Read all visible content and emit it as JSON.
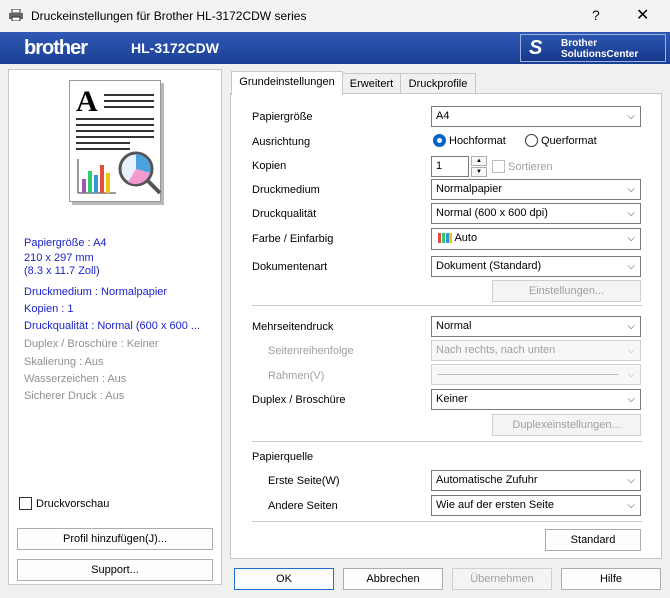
{
  "window": {
    "title": "Druckeinstellungen für Brother HL-3172CDW series",
    "help": "?",
    "close": "✕"
  },
  "brand": {
    "logo": "brother",
    "model": "HL-3172CDW",
    "solutions_line1": "Brother",
    "solutions_line2": "SolutionsCenter"
  },
  "summary": {
    "paper": "Papiergröße : A4",
    "dims1": "210 x 297 mm",
    "dims2": "(8.3 x 11.7 Zoll)",
    "media": "Druckmedium : Normalpapier",
    "copies": "Kopien : 1",
    "quality": "Druckqualität : Normal (600 x 600 ...",
    "duplex": "Duplex / Broschüre : Keiner",
    "scaling": "Skalierung : Aus",
    "watermark": "Wasserzeichen : Aus",
    "secure": "Sicherer Druck : Aus"
  },
  "left": {
    "preview_label": "Druckvorschau",
    "add_profile": "Profil hinzufügen(J)...",
    "support": "Support..."
  },
  "tabs": [
    "Grundeinstellungen",
    "Erweitert",
    "Druckprofile"
  ],
  "form": {
    "paper_label": "Papiergröße",
    "paper_value": "A4",
    "orientation_label": "Ausrichtung",
    "portrait": "Hochformat",
    "landscape": "Querformat",
    "copies_label": "Kopien",
    "copies_value": "1",
    "collate": "Sortieren",
    "media_label": "Druckmedium",
    "media_value": "Normalpapier",
    "quality_label": "Druckqualität",
    "quality_value": "Normal (600 x 600 dpi)",
    "color_label": "Farbe / Einfarbig",
    "color_value": "Auto",
    "doctype_label": "Dokumentenart",
    "doctype_value": "Dokument (Standard)",
    "settings_btn": "Einstellungen...",
    "multipage_label": "Mehrseitendruck",
    "multipage_value": "Normal",
    "order_label": "Seitenreihenfolge",
    "order_value": "Nach rechts, nach unten",
    "border_label": "Rahmen(V)",
    "duplex_label": "Duplex / Broschüre",
    "duplex_value": "Keiner",
    "duplex_btn": "Duplexeinstellungen...",
    "source_label": "Papierquelle",
    "first_label": "Erste Seite(W)",
    "first_value": "Automatische Zufuhr",
    "other_label": "Andere Seiten",
    "other_value": "Wie auf der ersten Seite",
    "default_btn": "Standard"
  },
  "footer": {
    "ok": "OK",
    "cancel": "Abbrechen",
    "apply": "Übernehmen",
    "help": "Hilfe"
  },
  "colors": {
    "brand_blue": "#1b3f94",
    "summary_blue": "#1b23c9",
    "radio_accent": "#0063c9"
  }
}
